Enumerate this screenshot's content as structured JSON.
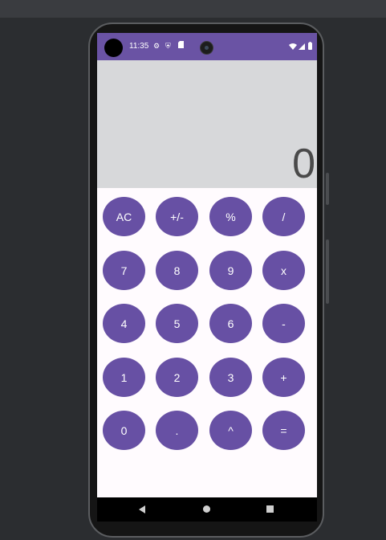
{
  "status_bar": {
    "time": "11:35",
    "icons": [
      "gear-icon",
      "shield-icon",
      "sim-card-icon",
      "wifi-icon",
      "signal-icon",
      "battery-icon"
    ]
  },
  "display": {
    "value": "0"
  },
  "keypad": {
    "keys": [
      [
        "AC",
        "+/-",
        "%",
        "/"
      ],
      [
        "7",
        "8",
        "9",
        "x"
      ],
      [
        "4",
        "5",
        "6",
        "-"
      ],
      [
        "1",
        "2",
        "3",
        "+"
      ],
      [
        "0",
        ".",
        "^",
        "="
      ]
    ]
  },
  "colors": {
    "status_bar": "#6a53a4",
    "key": "#6750a4",
    "display_bg": "#d7d8da",
    "screen_bg": "#fffbfe"
  },
  "navigation": {
    "icons": [
      "back-icon",
      "home-icon",
      "recents-icon"
    ]
  }
}
